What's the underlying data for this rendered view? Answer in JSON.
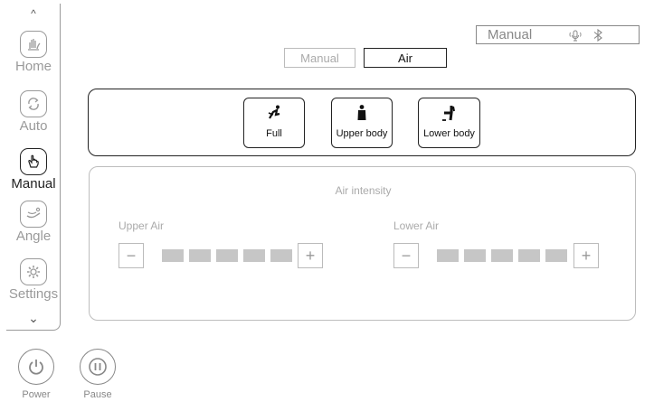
{
  "sidebar": {
    "items": [
      {
        "label": "Home",
        "icon": "home-hand-icon"
      },
      {
        "label": "Auto",
        "icon": "auto-cycle-icon"
      },
      {
        "label": "Manual",
        "icon": "manual-hand-icon",
        "active": true
      },
      {
        "label": "Angle",
        "icon": "recline-angle-icon"
      },
      {
        "label": "Settings",
        "icon": "gear-icon"
      }
    ],
    "scroll_up": "^",
    "scroll_down": "⌄"
  },
  "controls": {
    "power_label": "Power",
    "pause_label": "Pause"
  },
  "status": {
    "mode_text": "Manual",
    "icons": [
      "voice-icon",
      "bluetooth-icon"
    ]
  },
  "mode_tabs": {
    "manual_label": "Manual",
    "air_label": "Air",
    "selected": "Air"
  },
  "body_areas": [
    {
      "label": "Full",
      "icon": "full-body-icon"
    },
    {
      "label": "Upper body",
      "icon": "upper-body-icon"
    },
    {
      "label": "Lower body",
      "icon": "lower-body-icon"
    }
  ],
  "intensity": {
    "title": "Air intensity",
    "upper": {
      "label": "Upper Air",
      "level": 5,
      "max": 5
    },
    "lower": {
      "label": "Lower Air",
      "level": 5,
      "max": 5
    },
    "minus": "−",
    "plus": "+"
  },
  "colors": {
    "active": "#222222",
    "inactive": "#9a9a9a",
    "segment": "#c6c6c6"
  }
}
